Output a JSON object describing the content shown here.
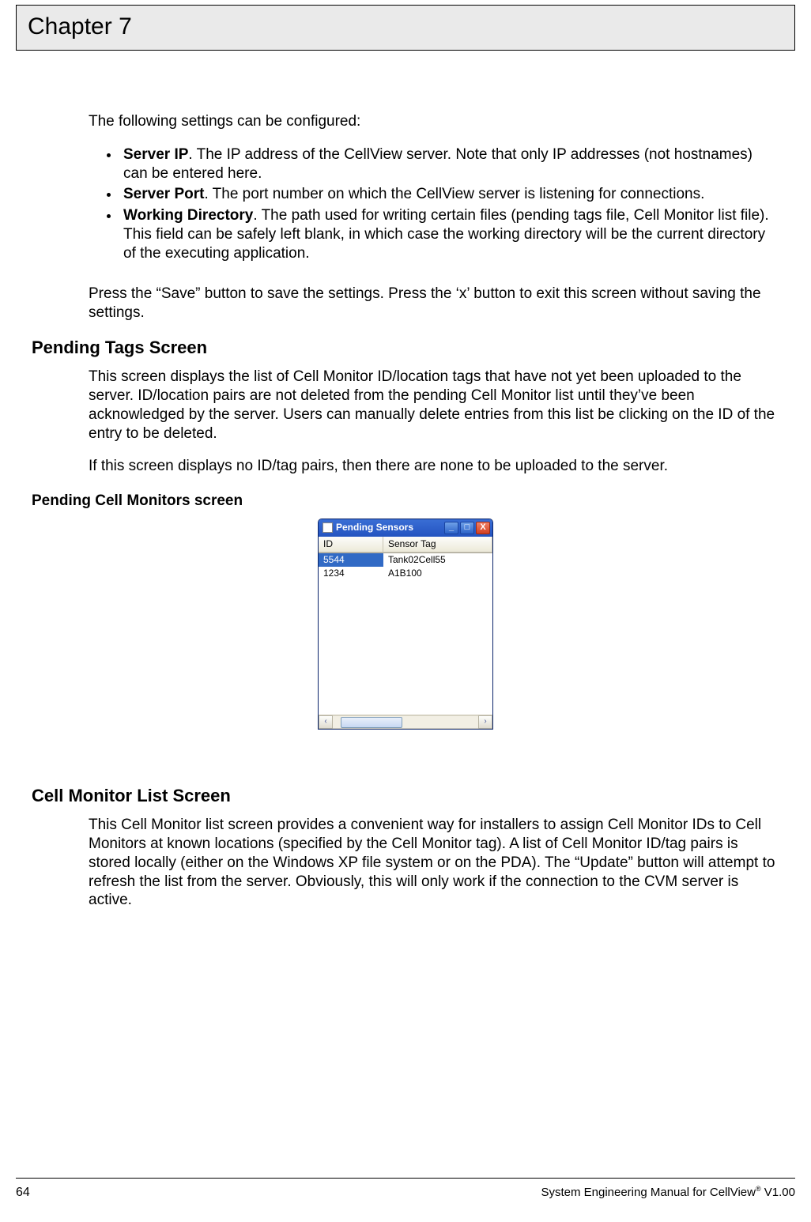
{
  "header": {
    "chapter": "Chapter 7"
  },
  "intro": "The following settings can be configured:",
  "bullets": [
    {
      "label": "Server IP",
      "text": ".  The IP address of the CellView server.  Note that only IP addresses (not hostnames) can be entered here."
    },
    {
      "label": "Server Port",
      "text": ". The port number on which the CellView server is listening for connections."
    },
    {
      "label": "Working Directory",
      "text": ". The path used for writing certain files (pending tags file, Cell Monitor list file).  This field can be safely left blank, in which case the working directory will be the current directory of the executing application."
    }
  ],
  "save_note": "Press the “Save” button to save the settings.  Press the ‘x’ button to exit this screen without saving the settings.",
  "sections": {
    "pending": {
      "title": "Pending Tags Screen",
      "p1": "This screen displays the list of Cell Monitor ID/location tags that have not yet been uploaded to the server.  ID/location pairs are not deleted from the pending Cell Monitor list until they’ve been acknowledged by the server.  Users can manually delete entries from this list be clicking on the ID of the entry to be deleted.",
      "p2": "If this screen displays no ID/tag pairs, then there are none to be uploaded to the server.",
      "caption": "Pending Cell Monitors screen"
    },
    "list": {
      "title": "Cell Monitor List Screen",
      "p1": "This Cell Monitor list screen provides a convenient way for installers to assign Cell Monitor IDs to Cell Monitors at known locations (specified by the Cell Monitor tag).  A list of Cell Monitor ID/tag pairs is stored locally (either on the Windows XP file system or on the PDA).  The “Update” button will attempt to refresh the list from the server.  Obviously, this will only work if the connection to the CVM server is active."
    }
  },
  "window": {
    "title": "Pending Sensors",
    "col_id": "ID",
    "col_tag": "Sensor Tag",
    "rows": [
      {
        "id": "5544",
        "tag": "Tank02Cell55",
        "selected": true
      },
      {
        "id": "1234",
        "tag": "A1B100",
        "selected": false
      }
    ],
    "btn_min": "_",
    "btn_max": "□",
    "btn_close": "X",
    "arrow_left": "‹",
    "arrow_right": "›"
  },
  "footer": {
    "page": "64",
    "doc1": "System Engineering Manual for CellView",
    "reg": "®",
    "doc2": " V1.00"
  }
}
